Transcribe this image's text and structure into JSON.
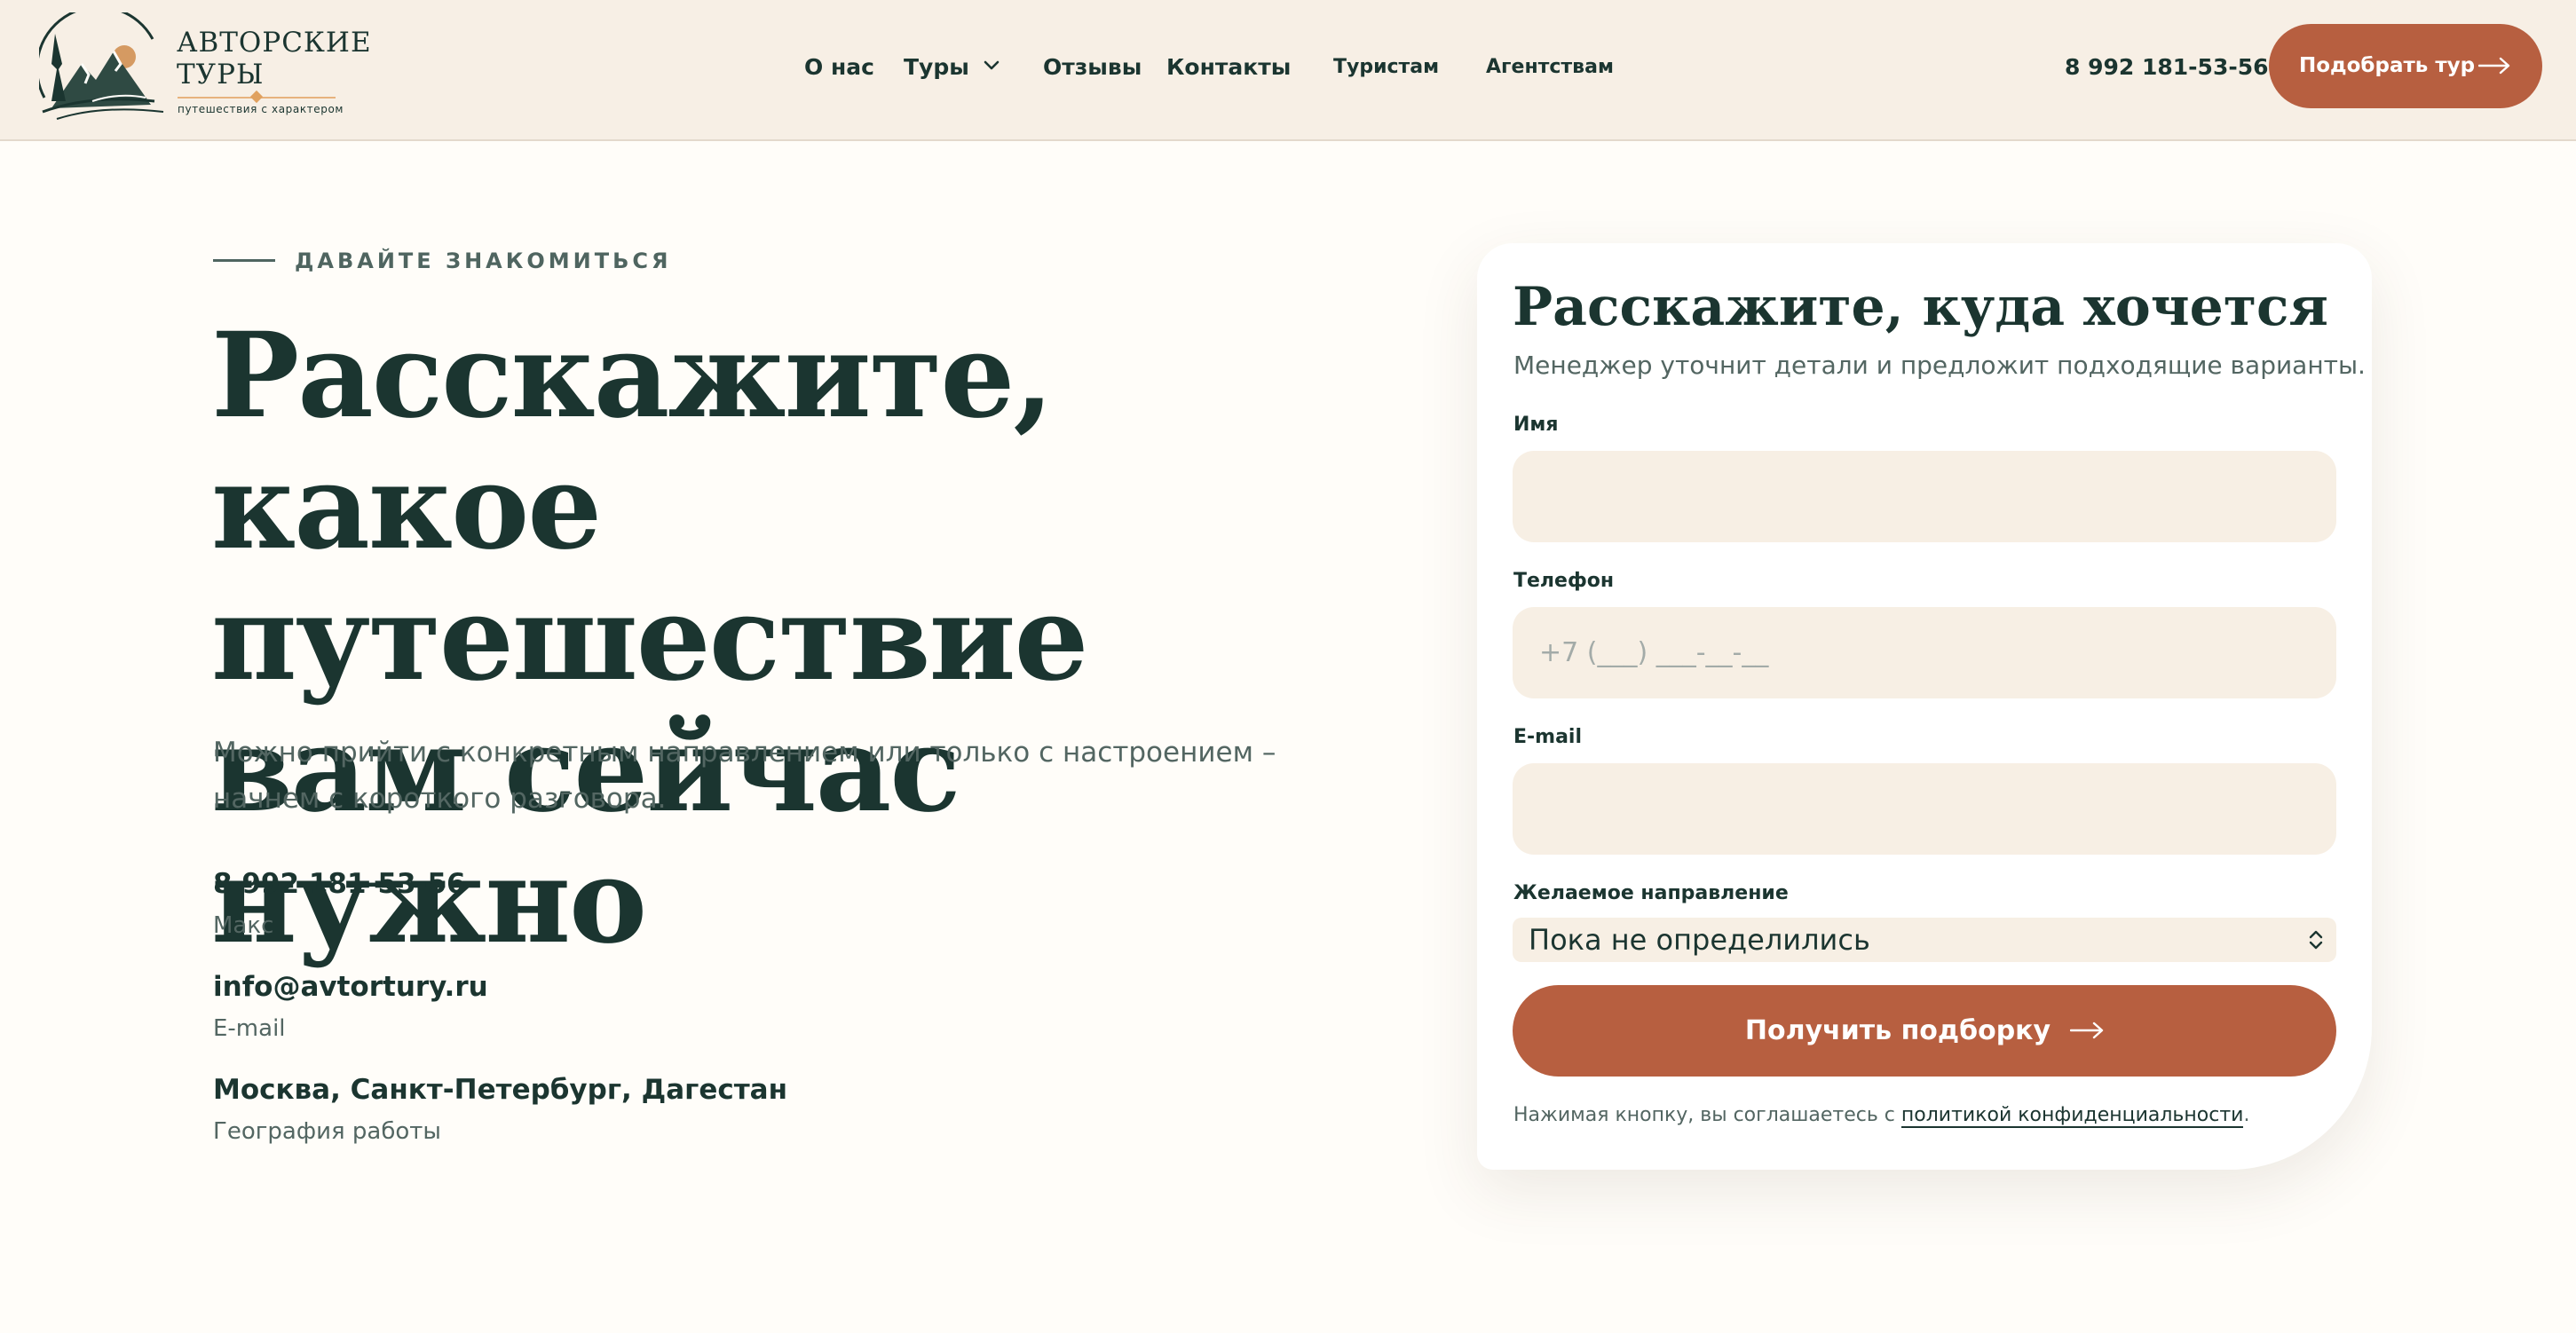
{
  "brand": {
    "name": "АВТОРСКИЕ ТУРЫ",
    "tagline": "путешествия с характером",
    "colors": {
      "accent": "#b75f40",
      "dark": "#1b3530",
      "header_bg": "#f7efe5",
      "input_bg": "#f7efe4",
      "gold": "#e0a15f"
    }
  },
  "nav": {
    "items": [
      {
        "label": "О нас"
      },
      {
        "label": "Туры",
        "icon": "chevron-down-icon"
      },
      {
        "label": "Отзывы"
      },
      {
        "label": "Контакты"
      },
      {
        "label": "Туристам"
      },
      {
        "label": "Агентствам"
      }
    ]
  },
  "header": {
    "phone": "8 992 181-53-56",
    "cta_label": "Подобрать тур",
    "cta_icon": "arrow-right-icon"
  },
  "hero": {
    "eyebrow": "ДАВАЙТЕ ЗНАКОМИТЬСЯ",
    "title": "Расскажите, какое путешествие вам сейчас нужно",
    "lead": "Можно прийти с конкретным направлением или только с настроением – начнем с короткого разговора.",
    "contacts": [
      {
        "value": "8 992 181-53-56",
        "caption": "Макс"
      },
      {
        "value": "info@avtortury.ru",
        "caption": "E-mail"
      },
      {
        "value": "Москва, Санкт-Петербург, Дагестан",
        "caption": "География работы"
      }
    ]
  },
  "form": {
    "title": "Расскажите, куда хочется",
    "subtitle": "Менеджер уточнит детали и предложит подходящие варианты.",
    "name_label": "Имя",
    "name_value": "",
    "phone_label": "Телефон",
    "phone_placeholder": "+7 (___) ___-__-__",
    "email_label": "E-mail",
    "email_value": "",
    "direction_label": "Желаемое направление",
    "direction_selected": "Пока не определились",
    "submit_label": "Получить подборку",
    "consent_prefix": "Нажимая кнопку, вы соглашаетесь с ",
    "consent_link": "политикой конфиденциальности",
    "consent_suffix": "."
  }
}
